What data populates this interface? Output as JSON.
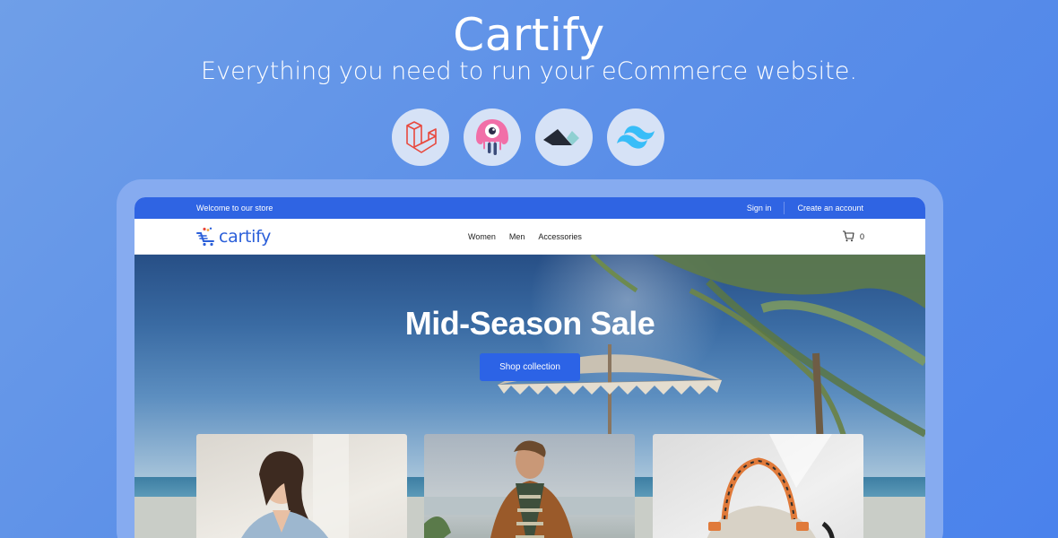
{
  "promo": {
    "title": "Cartify",
    "subtitle": "Everything you need to run your eCommerce website.",
    "tech_icons": [
      "laravel-icon",
      "livewire-icon",
      "filament-icon",
      "tailwind-icon"
    ]
  },
  "store": {
    "topbar": {
      "welcome": "Welcome to our store",
      "sign_in": "Sign in",
      "create_account": "Create an account"
    },
    "logo_text": "cartify",
    "nav": [
      "Women",
      "Men",
      "Accessories"
    ],
    "cart_count": "0",
    "banner": {
      "headline": "Mid-Season Sale",
      "cta": "Shop collection"
    }
  },
  "colors": {
    "accent": "#2f64e3",
    "background": "#5a8ee8",
    "frame": "#86abf0"
  }
}
